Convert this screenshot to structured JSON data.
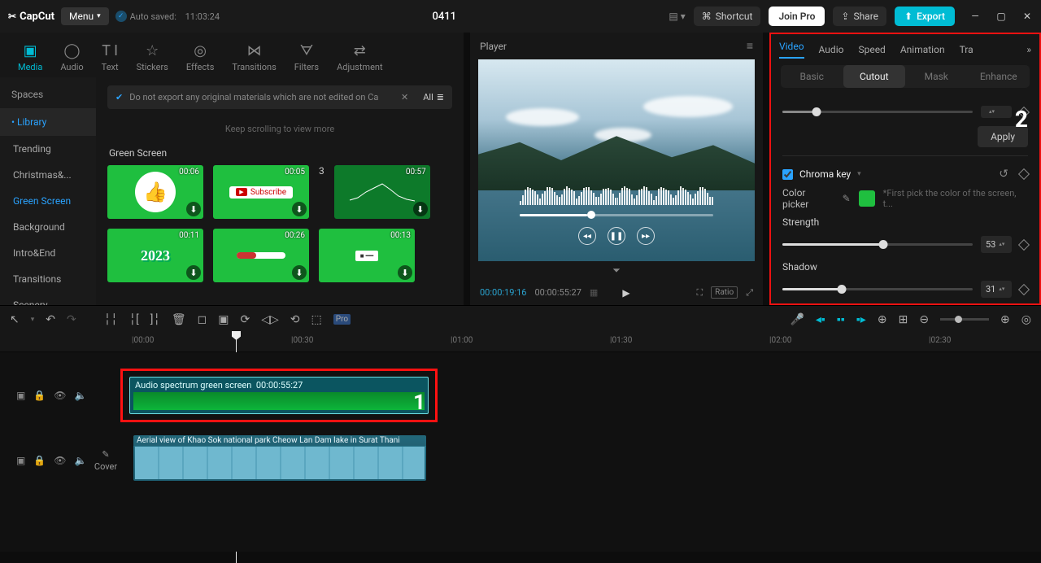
{
  "titlebar": {
    "logo": "CapCut",
    "menu": "Menu",
    "autosaved_prefix": "Auto saved:",
    "autosaved_time": "11:03:24",
    "project_title": "0411",
    "shortcut": "Shortcut",
    "join_pro": "Join Pro",
    "share": "Share",
    "export": "Export"
  },
  "primary_tabs": [
    "Media",
    "Audio",
    "Text",
    "Stickers",
    "Effects",
    "Transitions",
    "Filters",
    "Adjustment"
  ],
  "primary_icons": [
    "▣",
    "◯",
    "T I",
    "☆",
    "◎",
    "⋈",
    "ᗊ",
    "⇄"
  ],
  "side_cats": {
    "spaces": "Spaces",
    "library": "Library",
    "items": [
      "Trending",
      "Christmas&...",
      "Green Screen",
      "Background",
      "Intro&End",
      "Transitions",
      "Scenery"
    ]
  },
  "notice": {
    "text": "Do not export any original materials which are not edited on Ca",
    "all": "All"
  },
  "scroll_hint": "Keep scrolling to view more",
  "media_section": "Green Screen",
  "thumbs": [
    {
      "dur": "00:06"
    },
    {
      "dur": "00:05",
      "label": "Subscribe"
    },
    {
      "dur": "00:57"
    },
    {
      "dur": "00:11",
      "label": "2023"
    },
    {
      "dur": "00:26"
    },
    {
      "dur": "00:13"
    }
  ],
  "player": {
    "header": "Player",
    "time_current": "00:00:19:16",
    "time_total": "00:00:55:27",
    "ratio": "Ratio"
  },
  "right_tabs": [
    "Video",
    "Audio",
    "Speed",
    "Animation",
    "Tra"
  ],
  "sub_tabs": [
    "Basic",
    "Cutout",
    "Mask",
    "Enhance"
  ],
  "right": {
    "apply": "Apply",
    "chroma": "Chroma key",
    "color_picker": "Color picker",
    "picker_hint": "*First pick the color of the screen, t...",
    "strength_label": "Strength",
    "strength_value": "53",
    "shadow_label": "Shadow",
    "shadow_value": "31",
    "annot": "2"
  },
  "timeline_ticks": [
    "00:00",
    "00:30",
    "01:00",
    "01:30",
    "02:00",
    "02:30"
  ],
  "clip1": {
    "name": "Audio spectrum green screen",
    "dur": "00:00:55:27",
    "annot": "1"
  },
  "clip2": {
    "name": "Aerial view of Khao Sok national park Cheow Lan Dam lake in Surat Thani"
  },
  "cover_label": "Cover"
}
